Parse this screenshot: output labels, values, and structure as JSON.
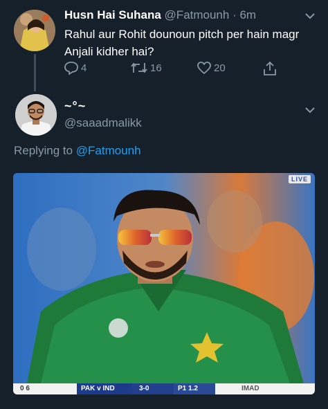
{
  "tweet1": {
    "display_name": "Husn Hai Suhana",
    "handle": "@Fatmounh",
    "separator": " · ",
    "timestamp": "6m",
    "text": "Rahul aur Rohit dounoun pitch per hain magr Anjali kidher hai?",
    "reply_count": "4",
    "retweet_count": "16",
    "like_count": "20"
  },
  "tweet2": {
    "display_name": "~°~",
    "handle": "@saaadmalikk",
    "replying_prefix": "Replying to ",
    "replying_to": "@Fatmounh"
  },
  "media": {
    "live_badge": "LIVE",
    "score_left": "0    6",
    "match": "PAK v IND",
    "score": "3-0",
    "innings": "P1  1.2",
    "batsman": "IMAD"
  },
  "colors": {
    "background": "#16202b",
    "secondary_text": "#8899a6",
    "accent": "#1da1f2"
  },
  "icons": {
    "reply": "reply-icon",
    "retweet": "retweet-icon",
    "like": "heart-icon",
    "share": "share-icon",
    "more": "chevron-down-icon"
  }
}
